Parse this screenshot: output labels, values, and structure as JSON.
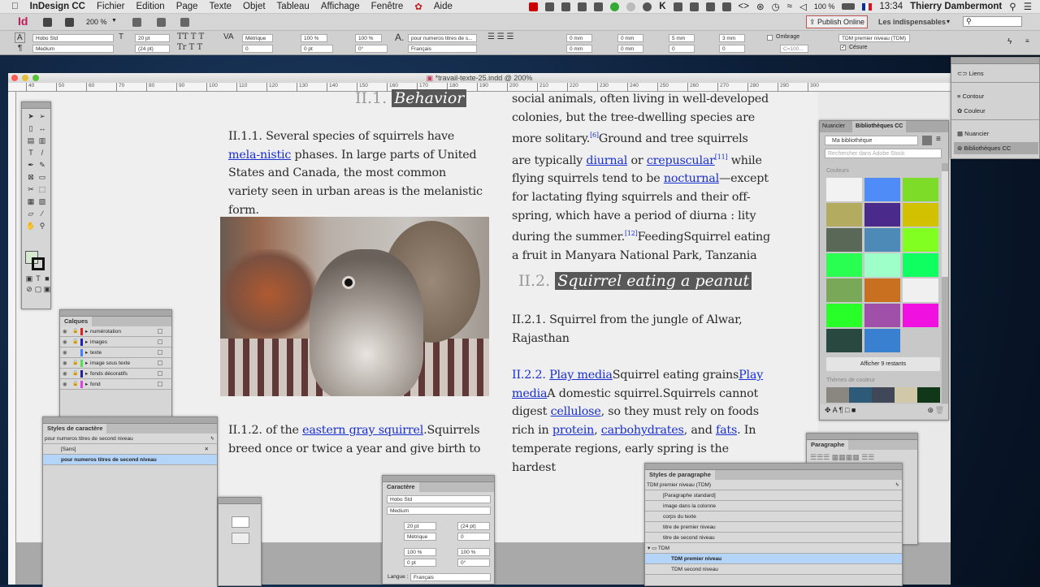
{
  "menubar": {
    "app": "InDesign CC",
    "items": [
      "Fichier",
      "Edition",
      "Page",
      "Texte",
      "Objet",
      "Tableau",
      "Affichage",
      "Fenêtre",
      "Aide"
    ],
    "battery": "100 %",
    "time": "13:34",
    "user": "Thierry Dambermont"
  },
  "appbar": {
    "logo": "Id",
    "zoom": "200 %",
    "publish": "Publish Online",
    "workspace": "Les indispensables",
    "search_placeholder": ""
  },
  "control": {
    "font": "Hobo Std",
    "style": "Medium",
    "size": "20 pt",
    "leading": "(24 pt)",
    "kerning": "Métrique",
    "tracking": "0",
    "vscale": "100 %",
    "hscale": "100 %",
    "baseline": "0 pt",
    "skew": "0°",
    "char_style": "pour numeros titres de s...",
    "language": "Français",
    "indent_left": "0 mm",
    "indent_right": "0 mm",
    "first_indent": "0 mm",
    "last_indent": "0 mm",
    "space_before": "5 mm",
    "space_after": "3 mm",
    "drop_lines": "0",
    "drop_chars": "0",
    "shading": "Ombrage",
    "shading_color": "C=100...",
    "para_style": "TDM premier niveau (TDM)",
    "cesure": "Césure"
  },
  "document": {
    "title": "*travail-texte-25.indd @ 200%",
    "ruler": [
      "40",
      "50",
      "60",
      "70",
      "80",
      "90",
      "100",
      "110",
      "120",
      "130",
      "140",
      "150",
      "160",
      "170",
      "180",
      "190",
      "200",
      "210",
      "220",
      "230",
      "240",
      "250",
      "260",
      "270",
      "280",
      "290",
      "300"
    ]
  },
  "content": {
    "h1_num": "II.1.",
    "h1_text": "Behavior",
    "p111_a": "II.1.1. Several species of squirrels have ",
    "p111_link": "mela-nistic",
    "p111_b": " phases. In large parts of United States and Canada, the most common variety seen in urban areas is the melanistic form.",
    "p112_a": "II.1.2.  of the ",
    "p112_link": "eastern gray squirrel",
    "p112_b": ".Squirrels breed once or twice a year and give birth to",
    "r1": "social animals, often living in well-developed colonies, but the tree-dwelling species are more solitary.",
    "r_sup6": "[6]",
    "r2": "Ground and tree squirrels are typically ",
    "r_l1": "diurnal",
    "r3": " or ",
    "r_l2": "crepuscular",
    "r_sup11": "[11]",
    "r4": " while flying squirrels tend to be ",
    "r_l3": "nocturnal",
    "r5": "—except for lactating flying squirrels and their off-spring, which have a period of diurna : lity during the summer.",
    "r_sup12": "[12]",
    "r6": "FeedingSquirrel eating a fruit in Manyara National Park, Tanzania",
    "h2_num": "II.2.",
    "h2_text": "Squirrel eating a peanut",
    "p221": "II.2.1. Squirrel from the jungle of Alwar, Rajasthan",
    "p222_num": "II.2.2.",
    "p222_l1": "Play media",
    "p222_a": "Squirrel eating grains",
    "p222_l2": "Play media",
    "p222_b": "A domestic squirrel.Squirrels cannot digest ",
    "p222_l3": "cellulose",
    "p222_c": ", so they must rely on foods rich in ",
    "p222_l4": "protein",
    "p222_d": ", ",
    "p222_l5": "carbohydrates",
    "p222_e": ", and ",
    "p222_l6": "fats",
    "p222_f": ". In temperate regions, early spring is the hardest"
  },
  "layers": {
    "title": "Calques",
    "items": [
      {
        "name": "numérotation",
        "color": "#e02020",
        "locked": true
      },
      {
        "name": "images",
        "color": "#2020c0",
        "locked": true
      },
      {
        "name": "texte",
        "color": "#4080ff",
        "locked": false
      },
      {
        "name": "image sous texte",
        "color": "#50e050",
        "locked": true
      },
      {
        "name": "fonds décoratifs",
        "color": "#2020a0",
        "locked": true
      },
      {
        "name": "fond",
        "color": "#e040e0",
        "locked": true
      }
    ]
  },
  "char_styles": {
    "title": "Styles de caractère",
    "current": "pour numeros titres de second niveau",
    "items": [
      "[Sans]",
      "pour numeros titres de second niveau"
    ]
  },
  "character": {
    "title": "Caractère",
    "font": "Hobo Std",
    "style": "Medium",
    "size": "20 pt",
    "leading": "(24 pt)",
    "kerning": "Métrique",
    "tracking": "0",
    "vscale": "100 %",
    "hscale": "100 %",
    "baseline": "0 pt",
    "skew": "0°",
    "lang_label": "Langue :",
    "lang": "Français"
  },
  "para_styles": {
    "title": "Styles de paragraphe",
    "current": "TDM premier niveau (TDM)",
    "items": [
      "[Paragraphe standard]",
      "image dans la colonne",
      "corps du texte",
      "titre de premier niveau",
      "titre de second niveau"
    ],
    "group": "TDM",
    "group_items": [
      "TDM premier niveau",
      "TDM second niveau"
    ]
  },
  "paragraph": {
    "title": "Paragraphe"
  },
  "libraries": {
    "tab1": "Nuancier",
    "tab2": "Bibliothèques CC",
    "library": "Ma bibliothèque",
    "search_placeholder": "Rechercher dans Adobe Stock",
    "colors_label": "Couleurs",
    "colors": [
      "#f2f2f2",
      "#4f8cf7",
      "#7ddc28",
      "#b3ac60",
      "#4a2a8a",
      "#d2c100",
      "#5a6858",
      "#4d8ab8",
      "#80ff20",
      "#28ff50",
      "#9effc8",
      "#10ff60",
      "#78a858",
      "#c87020",
      "#f0f0f0",
      "#28ff28",
      "#a050a8",
      "#f010e0",
      "#284840",
      "#3a80d0"
    ],
    "show_more": "Afficher 9 restants",
    "themes_label": "Thèmes de couleur",
    "theme": [
      "#8a8680",
      "#2e5a78",
      "#404858",
      "#d0c8a8",
      "#103818"
    ]
  },
  "dock": {
    "items": [
      "Liens",
      "Contour",
      "Couleur",
      "Nuancier",
      "Bibliothèques CC"
    ]
  }
}
